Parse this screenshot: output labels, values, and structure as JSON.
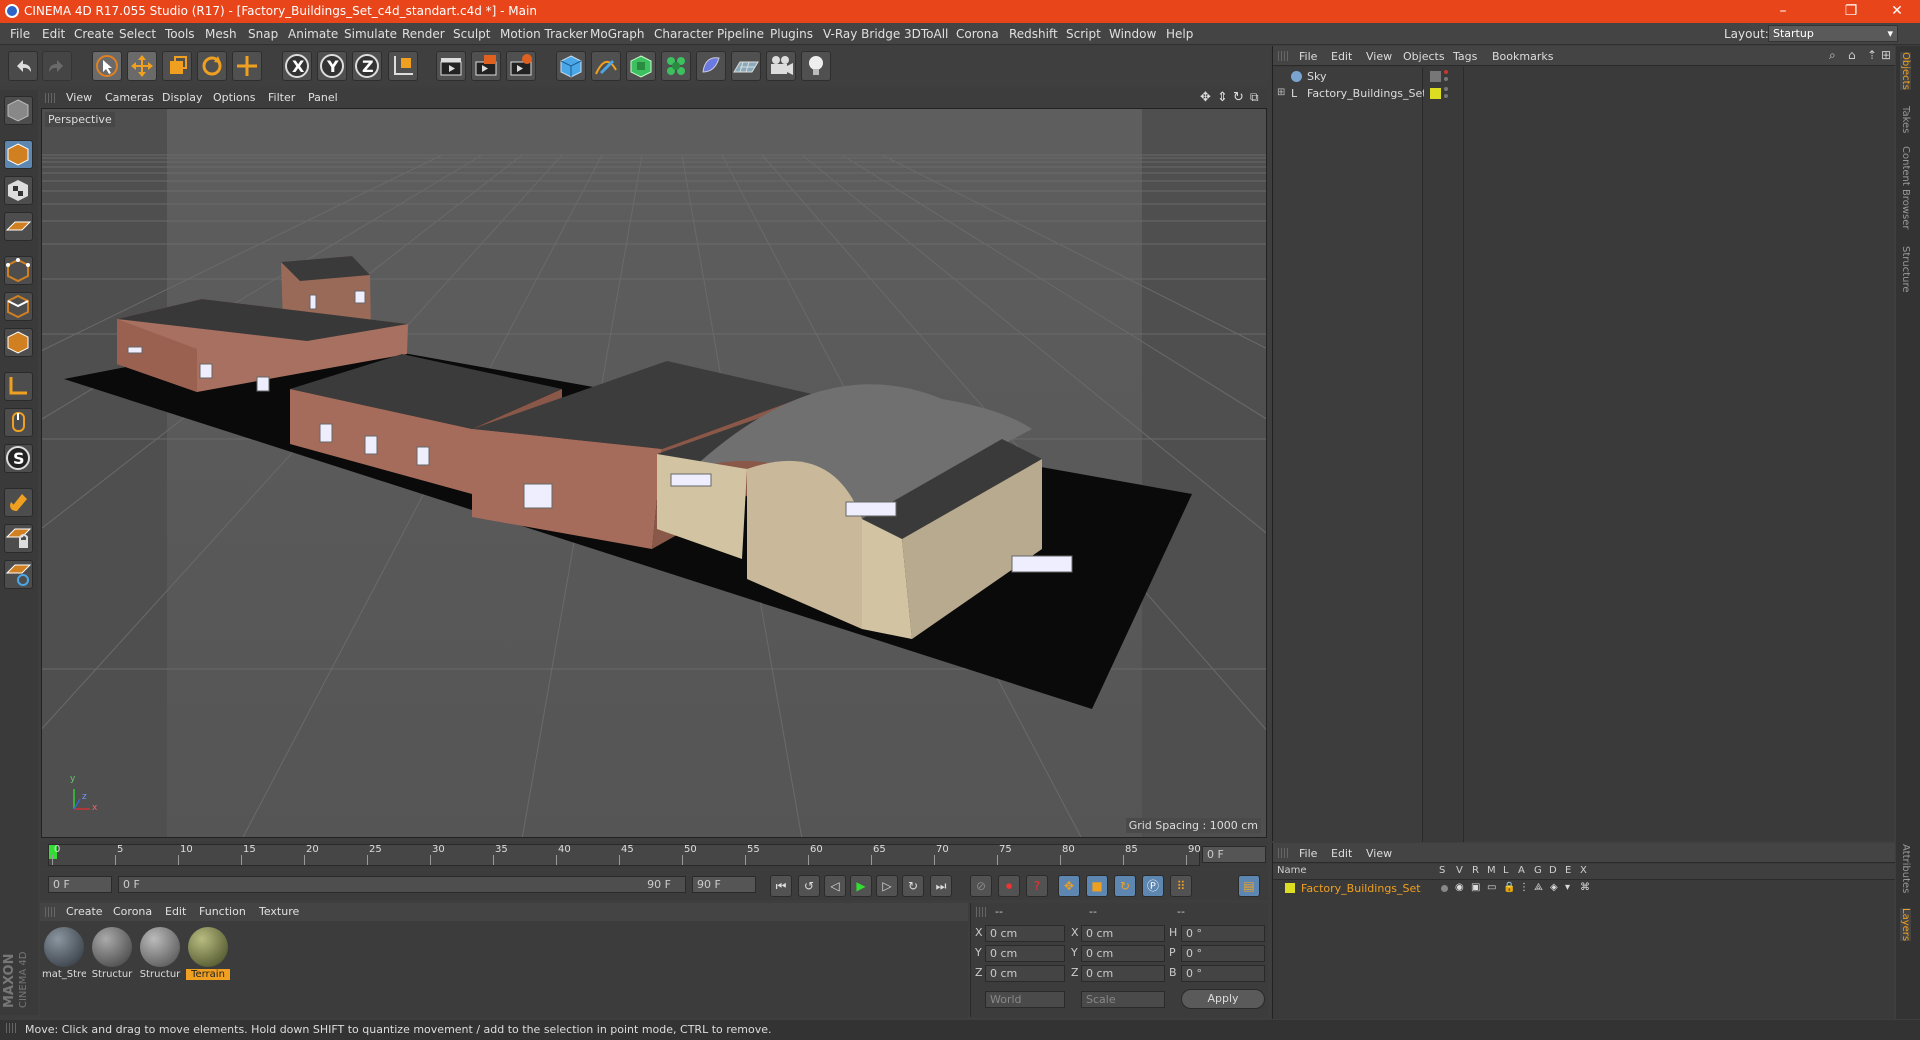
{
  "window": {
    "title": "CINEMA 4D R17.055 Studio (R17) - [Factory_Buildings_Set_c4d_standart.c4d *] - Main",
    "minimize": "–",
    "restore": "❐",
    "close": "✕"
  },
  "menu": [
    "File",
    "Edit",
    "Create",
    "Select",
    "Tools",
    "Mesh",
    "Snap",
    "Animate",
    "Simulate",
    "Render",
    "Sculpt",
    "Motion Tracker",
    "MoGraph",
    "Character",
    "Pipeline",
    "Plugins",
    "V-Ray Bridge",
    "3DToAll",
    "Corona",
    "Redshift",
    "Script",
    "Window",
    "Help"
  ],
  "layout": {
    "label": "Layout:",
    "value": "Startup"
  },
  "toolbar": {
    "axis_x": "X",
    "axis_y": "Y",
    "axis_z": "Z"
  },
  "viewport": {
    "menu": [
      "View",
      "Cameras",
      "Display",
      "Options",
      "Filter",
      "Panel"
    ],
    "name": "Perspective",
    "grid_spacing": "Grid Spacing : 1000 cm",
    "axis_y": "y",
    "axis_z": "z",
    "axis_x": "x"
  },
  "timeline": {
    "ticks": [
      "0",
      "5",
      "10",
      "15",
      "20",
      "25",
      "30",
      "35",
      "40",
      "45",
      "50",
      "55",
      "60",
      "65",
      "70",
      "75",
      "80",
      "85",
      "90"
    ],
    "current": "0 F"
  },
  "anim": {
    "start": "0 F",
    "range_start": "0 F",
    "range_end": "90 F",
    "end": "90 F"
  },
  "materials": {
    "menu": [
      "Create",
      "Corona",
      "Edit",
      "Function",
      "Texture"
    ],
    "items": [
      {
        "name": "mat_Stre",
        "color": "#4a5560"
      },
      {
        "name": "Structur",
        "color": "#6a6a6a"
      },
      {
        "name": "Structur",
        "color": "#7a7a78"
      },
      {
        "name": "Terrain",
        "color": "#6b7040"
      }
    ]
  },
  "coords": {
    "header": [
      "--",
      "--",
      "--"
    ],
    "rows": [
      {
        "a": "X",
        "av": "0 cm",
        "b": "X",
        "bv": "0 cm",
        "c": "H",
        "cv": "0 °"
      },
      {
        "a": "Y",
        "av": "0 cm",
        "b": "Y",
        "bv": "0 cm",
        "c": "P",
        "cv": "0 °"
      },
      {
        "a": "Z",
        "av": "0 cm",
        "b": "Z",
        "bv": "0 cm",
        "c": "B",
        "cv": "0 °"
      }
    ],
    "mode1": "World",
    "mode2": "Scale",
    "apply": "Apply"
  },
  "objects": {
    "menu": [
      "File",
      "Edit",
      "View",
      "Objects",
      "Tags",
      "Bookmarks"
    ],
    "items": [
      {
        "name": "Sky"
      },
      {
        "name": "Factory_Buildings_Set"
      }
    ]
  },
  "layers": {
    "menu": [
      "File",
      "Edit",
      "View"
    ],
    "col_name": "Name",
    "cols": [
      "S",
      "V",
      "R",
      "M",
      "L",
      "A",
      "G",
      "D",
      "E",
      "X"
    ],
    "row": "Factory_Buildings_Set"
  },
  "right_tabs": [
    "Objects",
    "Takes",
    "Content Browser",
    "Structure"
  ],
  "right_tabs2": [
    "Attributes",
    "Layers"
  ],
  "brand": {
    "maxon": "MAXON",
    "cinema": "CINEMA 4D"
  },
  "status": "Move: Click and drag to move elements. Hold down SHIFT to quantize movement / add to the selection in point mode, CTRL to remove."
}
